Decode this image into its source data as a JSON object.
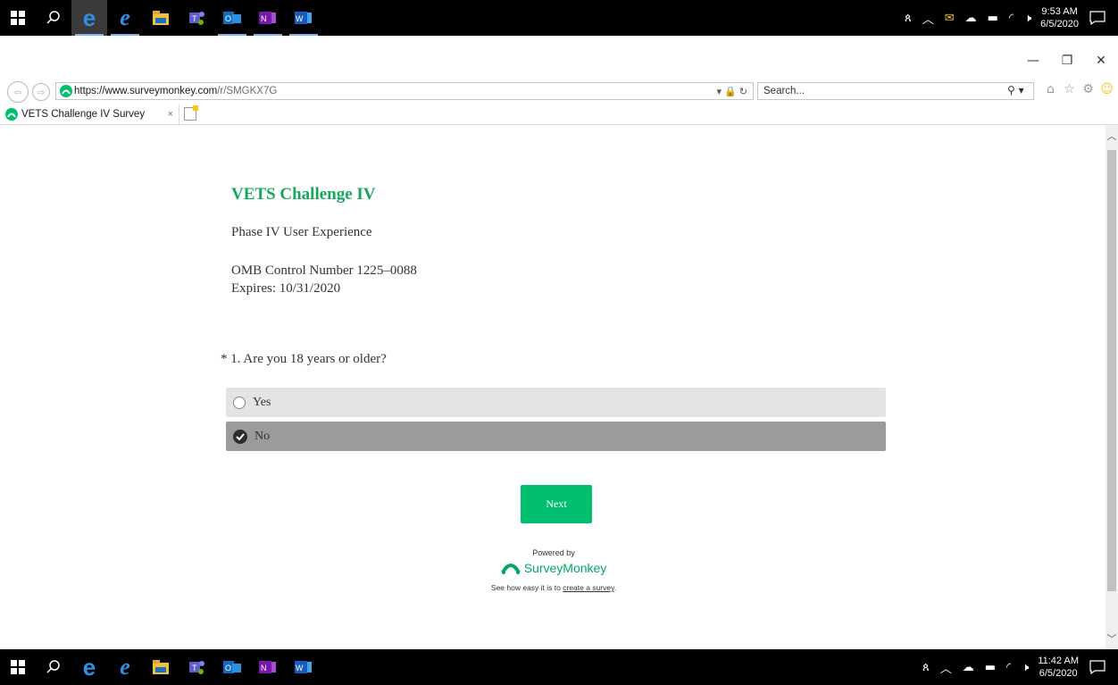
{
  "taskbar_top": {
    "clock_time": "9:53 AM",
    "clock_date": "6/5/2020",
    "apps": [
      "start-icon",
      "search-icon",
      "edge-icon",
      "ie-icon",
      "file-explorer-icon",
      "teams-icon",
      "outlook-icon",
      "onenote-icon",
      "word-icon"
    ]
  },
  "taskbar_bottom": {
    "clock_time": "11:42 AM",
    "clock_date": "6/5/2020"
  },
  "browser": {
    "url_host": "https://www.surveymonkey.com",
    "url_path": "/r/SMGKX7G",
    "search_placeholder": "Search...",
    "tab_title": "VETS Challenge IV Survey"
  },
  "survey": {
    "title": "VETS Challenge IV",
    "subtitle": "Phase IV User Experience",
    "omb_line1": "OMB Control Number 1225–0088",
    "omb_line2": "Expires: 10/31/2020",
    "question": "* 1. Are you 18 years or older?",
    "options": [
      {
        "label": "Yes",
        "selected": false
      },
      {
        "label": "No",
        "selected": true
      }
    ],
    "next_label": "Next"
  },
  "footer": {
    "powered_by": "Powered by",
    "brand": "SurveyMonkey",
    "see_how_prefix": "See how easy it is to ",
    "create_link": "create a survey",
    "see_how_suffix": "."
  },
  "colors": {
    "brand_green": "#00bf6f",
    "title_green": "#16a85a"
  }
}
